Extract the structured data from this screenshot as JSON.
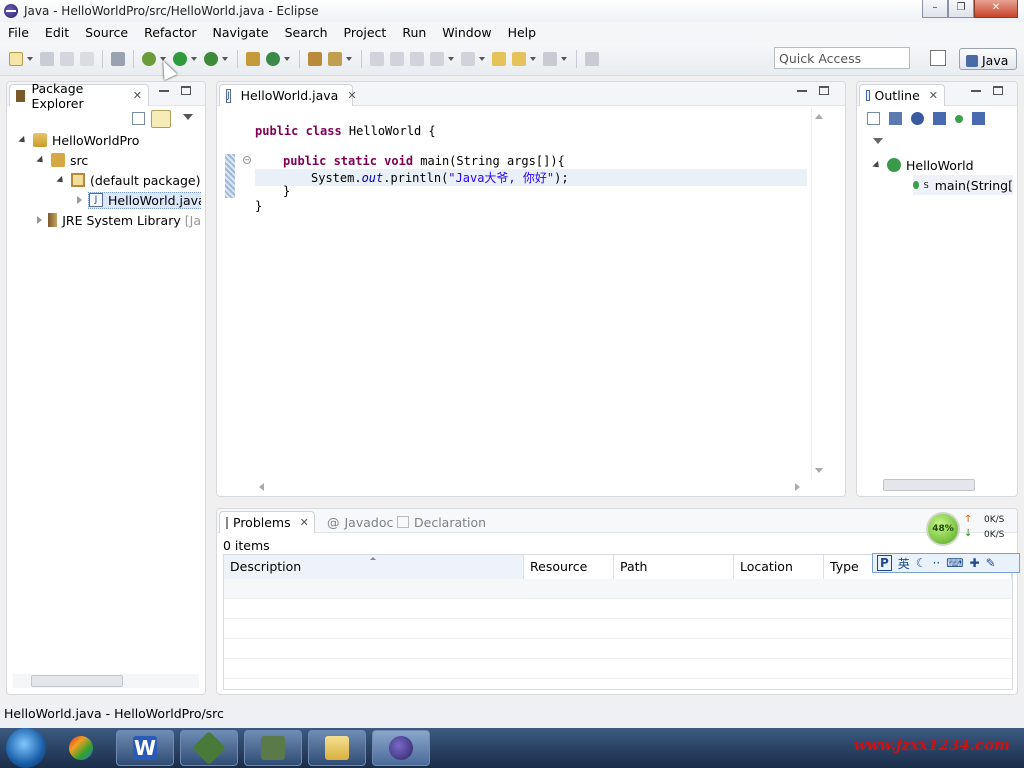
{
  "window": {
    "title": "Java - HelloWorldPro/src/HelloWorld.java - Eclipse",
    "minimize": "–",
    "maximize": "❐",
    "close": "✕"
  },
  "menu": [
    "File",
    "Edit",
    "Source",
    "Refactor",
    "Navigate",
    "Search",
    "Project",
    "Run",
    "Window",
    "Help"
  ],
  "toolbar": {
    "quick_access_placeholder": "Quick Access",
    "perspective": "Java"
  },
  "package_explorer": {
    "tab_label": "Package Explorer",
    "tree": [
      {
        "label": "HelloWorldPro"
      },
      {
        "label": "src"
      },
      {
        "label": "(default package)"
      },
      {
        "label": "HelloWorld.java"
      },
      {
        "label": "JRE System Library",
        "suffix": "[Ja"
      }
    ]
  },
  "editor": {
    "tab_label": "HelloWorld.java",
    "lines": {
      "l1_kw": "public class",
      "l1_rest": " HelloWorld {",
      "l2_kw": "public static void",
      "l2_rest": " main(String args[]){",
      "l3_pre": "System.",
      "l3_field": "out",
      "l3_mid": ".println(",
      "l3_str": "\"Java大爷, 你好\"",
      "l3_end": ");",
      "l4": "}",
      "l5": "}"
    }
  },
  "outline": {
    "tab_label": "Outline",
    "class_name": "HelloWorld",
    "method": "main(String["
  },
  "problems": {
    "tabs": [
      "Problems",
      "Javadoc",
      "Declaration"
    ],
    "count": "0 items",
    "columns": [
      "Description",
      "Resource",
      "Path",
      "Location",
      "Type"
    ]
  },
  "status_bar": {
    "text": "HelloWorld.java - HelloWorldPro/src"
  },
  "network_widget": {
    "percent": "48%",
    "up": "0K/S",
    "down": "0K/S"
  },
  "ime": {
    "lang": "英"
  },
  "watermark": "www.jzxx1234.com",
  "colors": {
    "keyword": "#7f0055",
    "string": "#2a00ff",
    "field": "#0000c0",
    "selection": "#dbe8fb"
  }
}
